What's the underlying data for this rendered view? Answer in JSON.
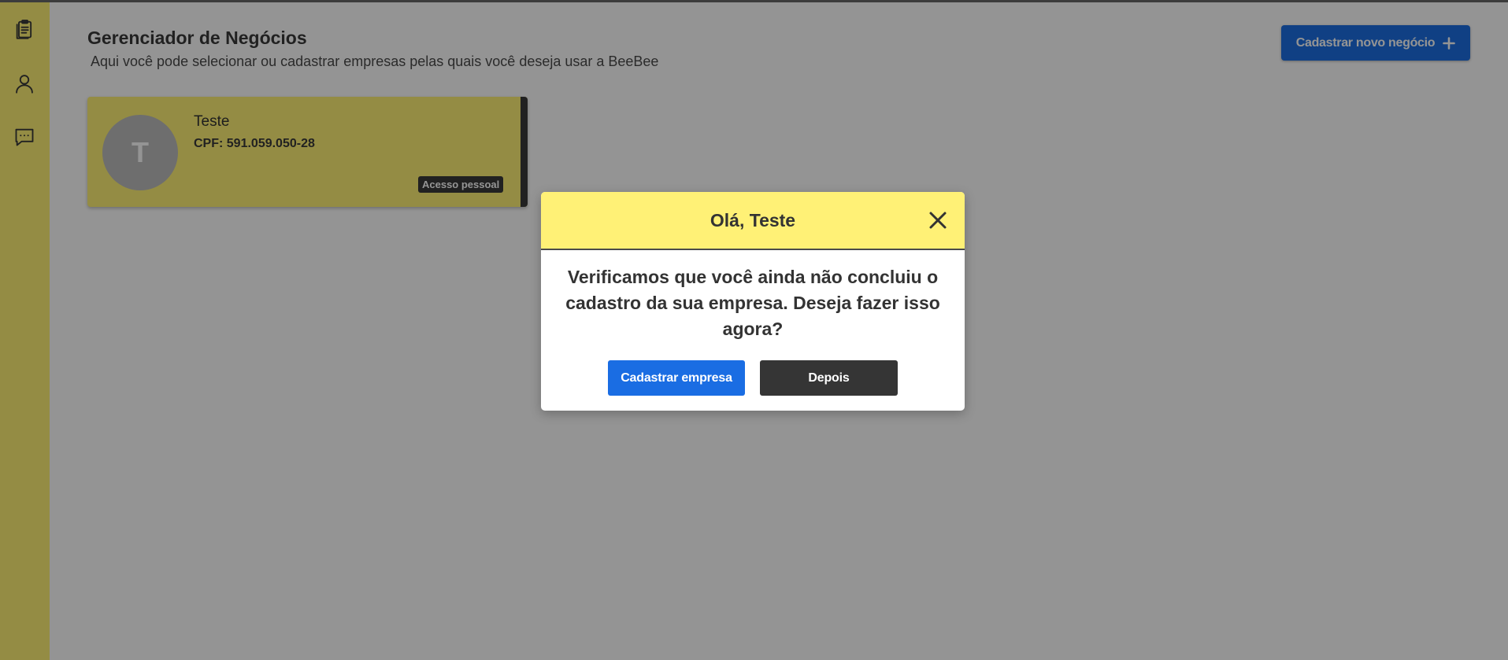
{
  "sidebar": {
    "items": [
      {
        "icon": "clipboard-icon"
      },
      {
        "icon": "user-icon"
      },
      {
        "icon": "chat-icon"
      }
    ]
  },
  "header": {
    "title": "Gerenciador de Negócios",
    "subtitle": "Aqui você pode selecionar ou cadastrar empresas pelas quais você deseja usar a BeeBee",
    "new_business_label": "Cadastrar novo negócio"
  },
  "businesses": [
    {
      "avatar_letter": "T",
      "name": "Teste",
      "document": "CPF: 591.059.050-28",
      "badge": "Acesso pessoal"
    }
  ],
  "modal": {
    "title": "Olá, Teste",
    "message": "Verificamos que você ainda não concluiu o cadastro da sua empresa. Deseja fazer isso agora?",
    "primary_label": "Cadastrar empresa",
    "secondary_label": "Depois"
  },
  "colors": {
    "brand_yellow": "#fff176",
    "primary_blue": "#1a6de3",
    "dark": "#353535",
    "overlay": "rgba(0,0,0,0.42)"
  }
}
